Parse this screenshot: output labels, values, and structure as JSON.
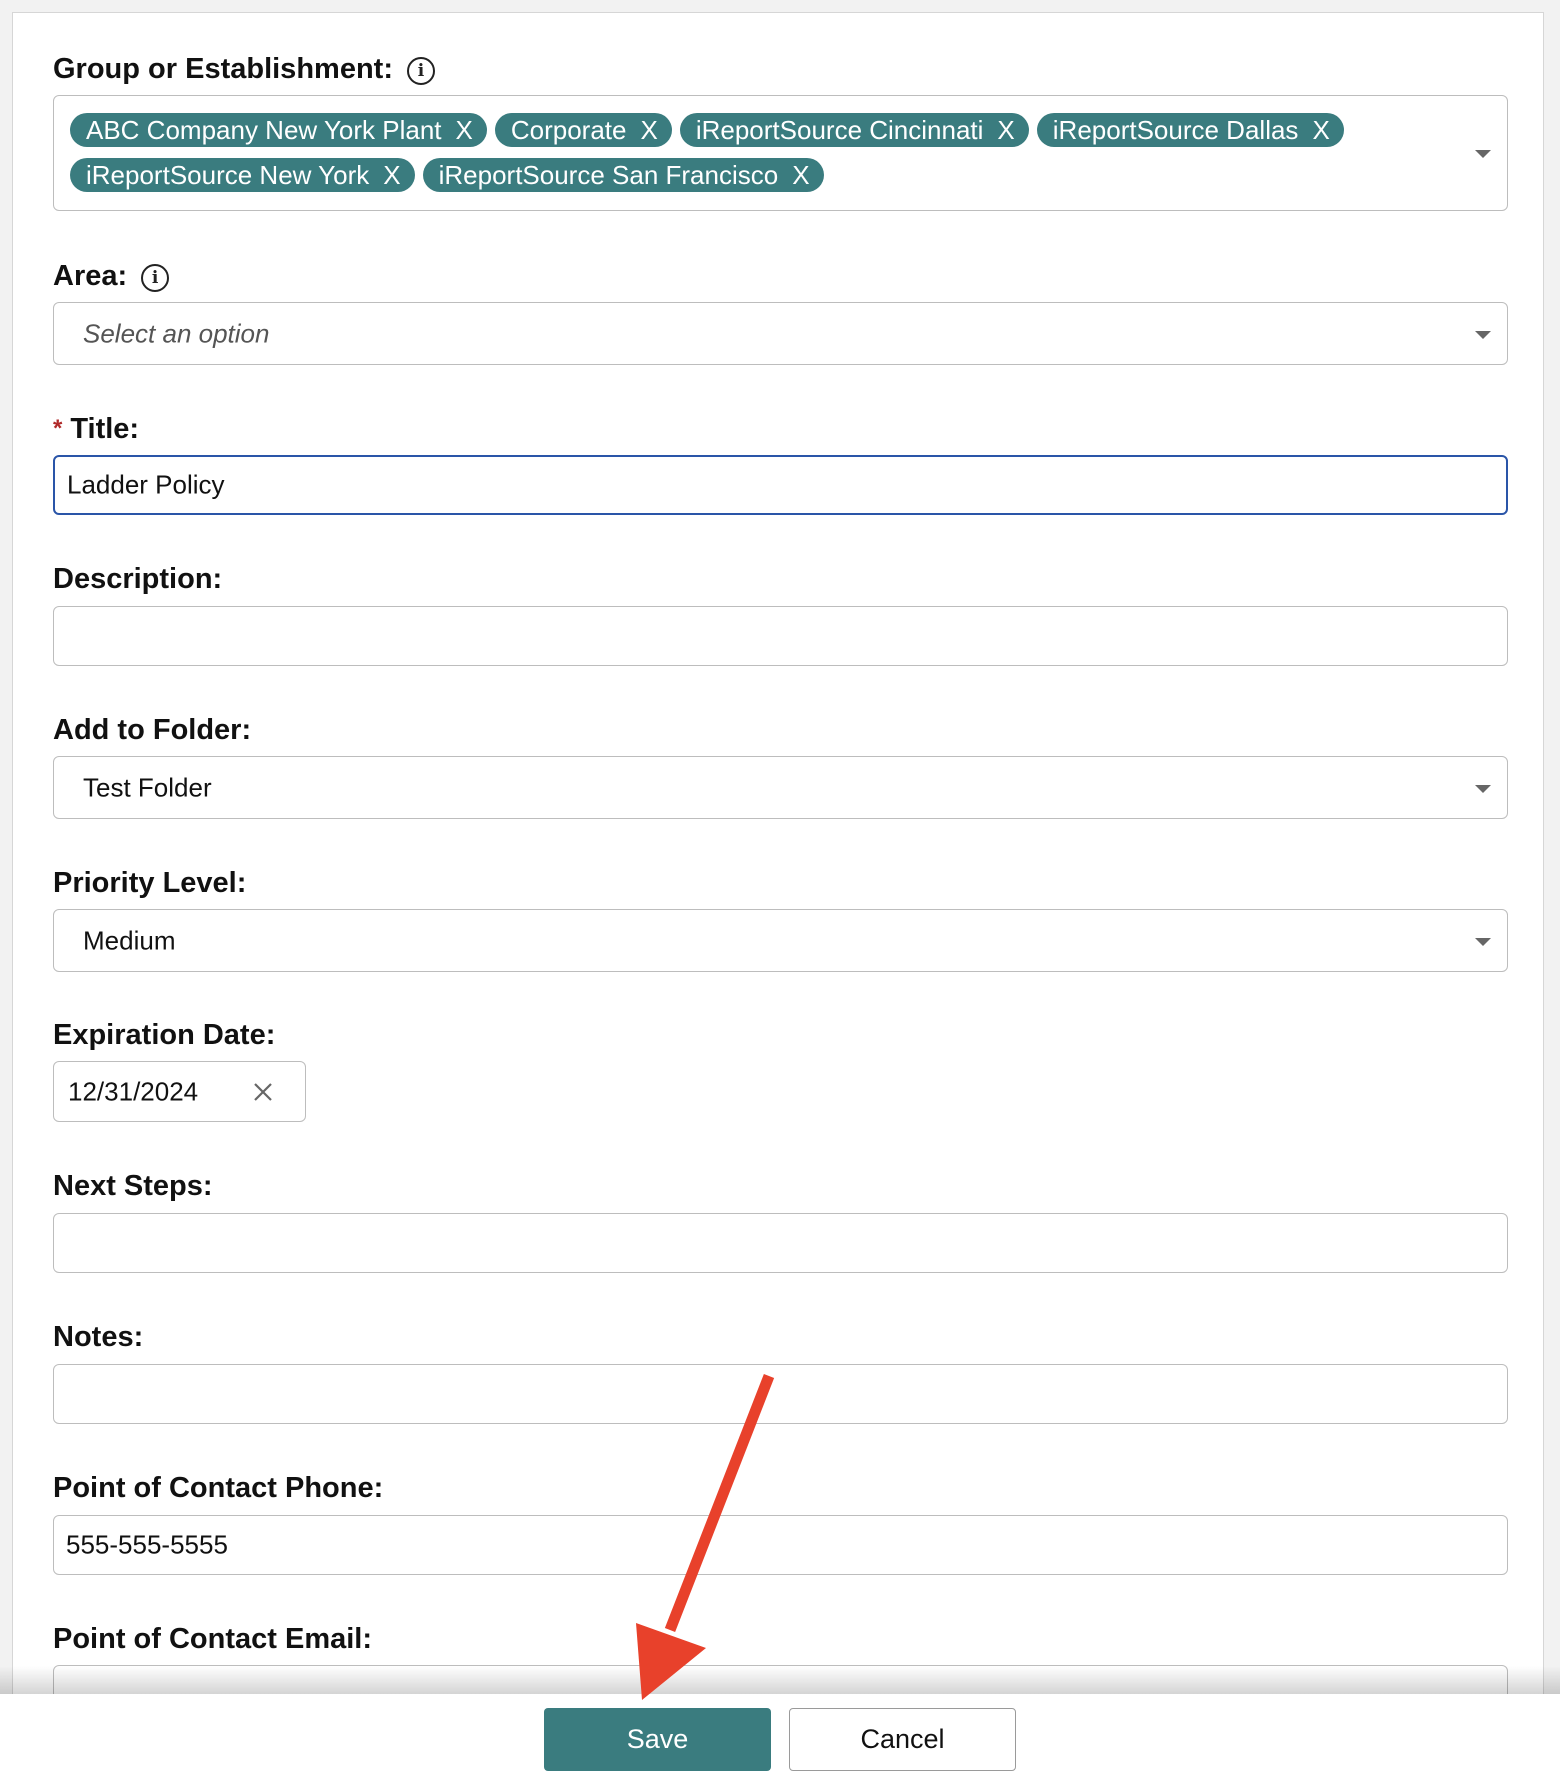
{
  "form": {
    "group": {
      "label": "Group or Establishment:",
      "selected": [
        "ABC Company New York Plant",
        "Corporate",
        "iReportSource Cincinnati",
        "iReportSource Dallas",
        "iReportSource New York",
        "iReportSource San Francisco"
      ],
      "remove_glyph": "X"
    },
    "area": {
      "label": "Area:",
      "placeholder": "Select an option"
    },
    "title": {
      "required_mark": "*",
      "label": "Title:",
      "value": "Ladder Policy"
    },
    "description": {
      "label": "Description:",
      "value": ""
    },
    "folder": {
      "label": "Add to Folder:",
      "value": "Test Folder"
    },
    "priority": {
      "label": "Priority Level:",
      "value": "Medium"
    },
    "expiration": {
      "label": "Expiration Date:",
      "value": "12/31/2024"
    },
    "next_steps": {
      "label": "Next Steps:",
      "value": ""
    },
    "notes": {
      "label": "Notes:",
      "value": ""
    },
    "contact_phone": {
      "label": "Point of Contact Phone:",
      "value": "555-555-5555"
    },
    "contact_email": {
      "label": "Point of Contact Email:",
      "value": ""
    }
  },
  "footer": {
    "save_label": "Save",
    "cancel_label": "Cancel"
  },
  "colors": {
    "accent": "#3a7c7f",
    "focus": "#2a55a8",
    "annotation_arrow": "#e8412b",
    "required": "#b02a2a"
  },
  "icons": {
    "info": "info-circle-icon",
    "caret": "caret-down-icon",
    "clear": "close-icon",
    "annotation": "red-arrow"
  }
}
